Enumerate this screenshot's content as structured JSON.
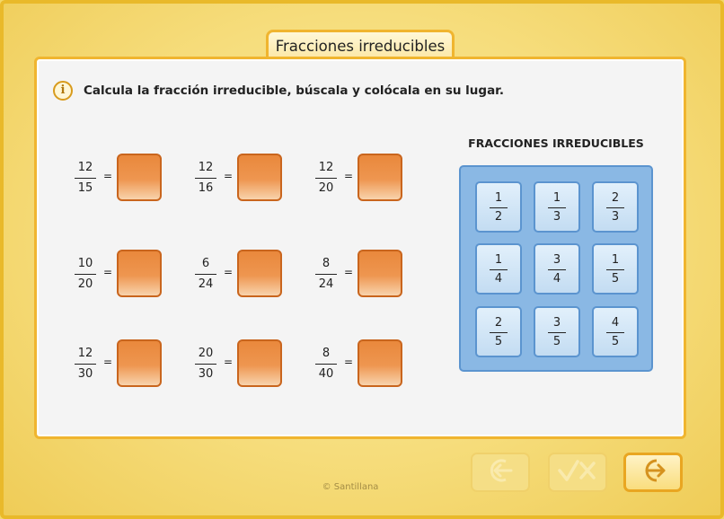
{
  "title": "Fracciones irreducibles",
  "instruction": {
    "icon": "info-icon",
    "icon_glyph": "i",
    "text": "Calcula la fracción irreducible, búscala y colócala en su lugar."
  },
  "equations": [
    {
      "num": "12",
      "den": "15"
    },
    {
      "num": "12",
      "den": "16"
    },
    {
      "num": "12",
      "den": "20"
    },
    {
      "num": "10",
      "den": "20"
    },
    {
      "num": "6",
      "den": "24"
    },
    {
      "num": "8",
      "den": "24"
    },
    {
      "num": "12",
      "den": "30"
    },
    {
      "num": "20",
      "den": "30"
    },
    {
      "num": "8",
      "den": "40"
    }
  ],
  "equals_sign": "=",
  "bank": {
    "title": "FRACCIONES IRREDUCIBLES",
    "tiles": [
      {
        "num": "1",
        "den": "2"
      },
      {
        "num": "1",
        "den": "3"
      },
      {
        "num": "2",
        "den": "3"
      },
      {
        "num": "1",
        "den": "4"
      },
      {
        "num": "3",
        "den": "4"
      },
      {
        "num": "1",
        "den": "5"
      },
      {
        "num": "2",
        "den": "5"
      },
      {
        "num": "3",
        "den": "5"
      },
      {
        "num": "4",
        "den": "5"
      }
    ]
  },
  "buttons": {
    "back": {
      "icon": "back-arrow-icon",
      "enabled": false
    },
    "check": {
      "icon": "check-cross-icon",
      "enabled": false
    },
    "next": {
      "icon": "next-arrow-icon",
      "enabled": true
    }
  },
  "footer": {
    "copyright": "© Santillana"
  },
  "colors": {
    "slot_orange": "#e9883c",
    "bank_blue": "#8ab8e4",
    "frame_yellow": "#f0b52f"
  }
}
